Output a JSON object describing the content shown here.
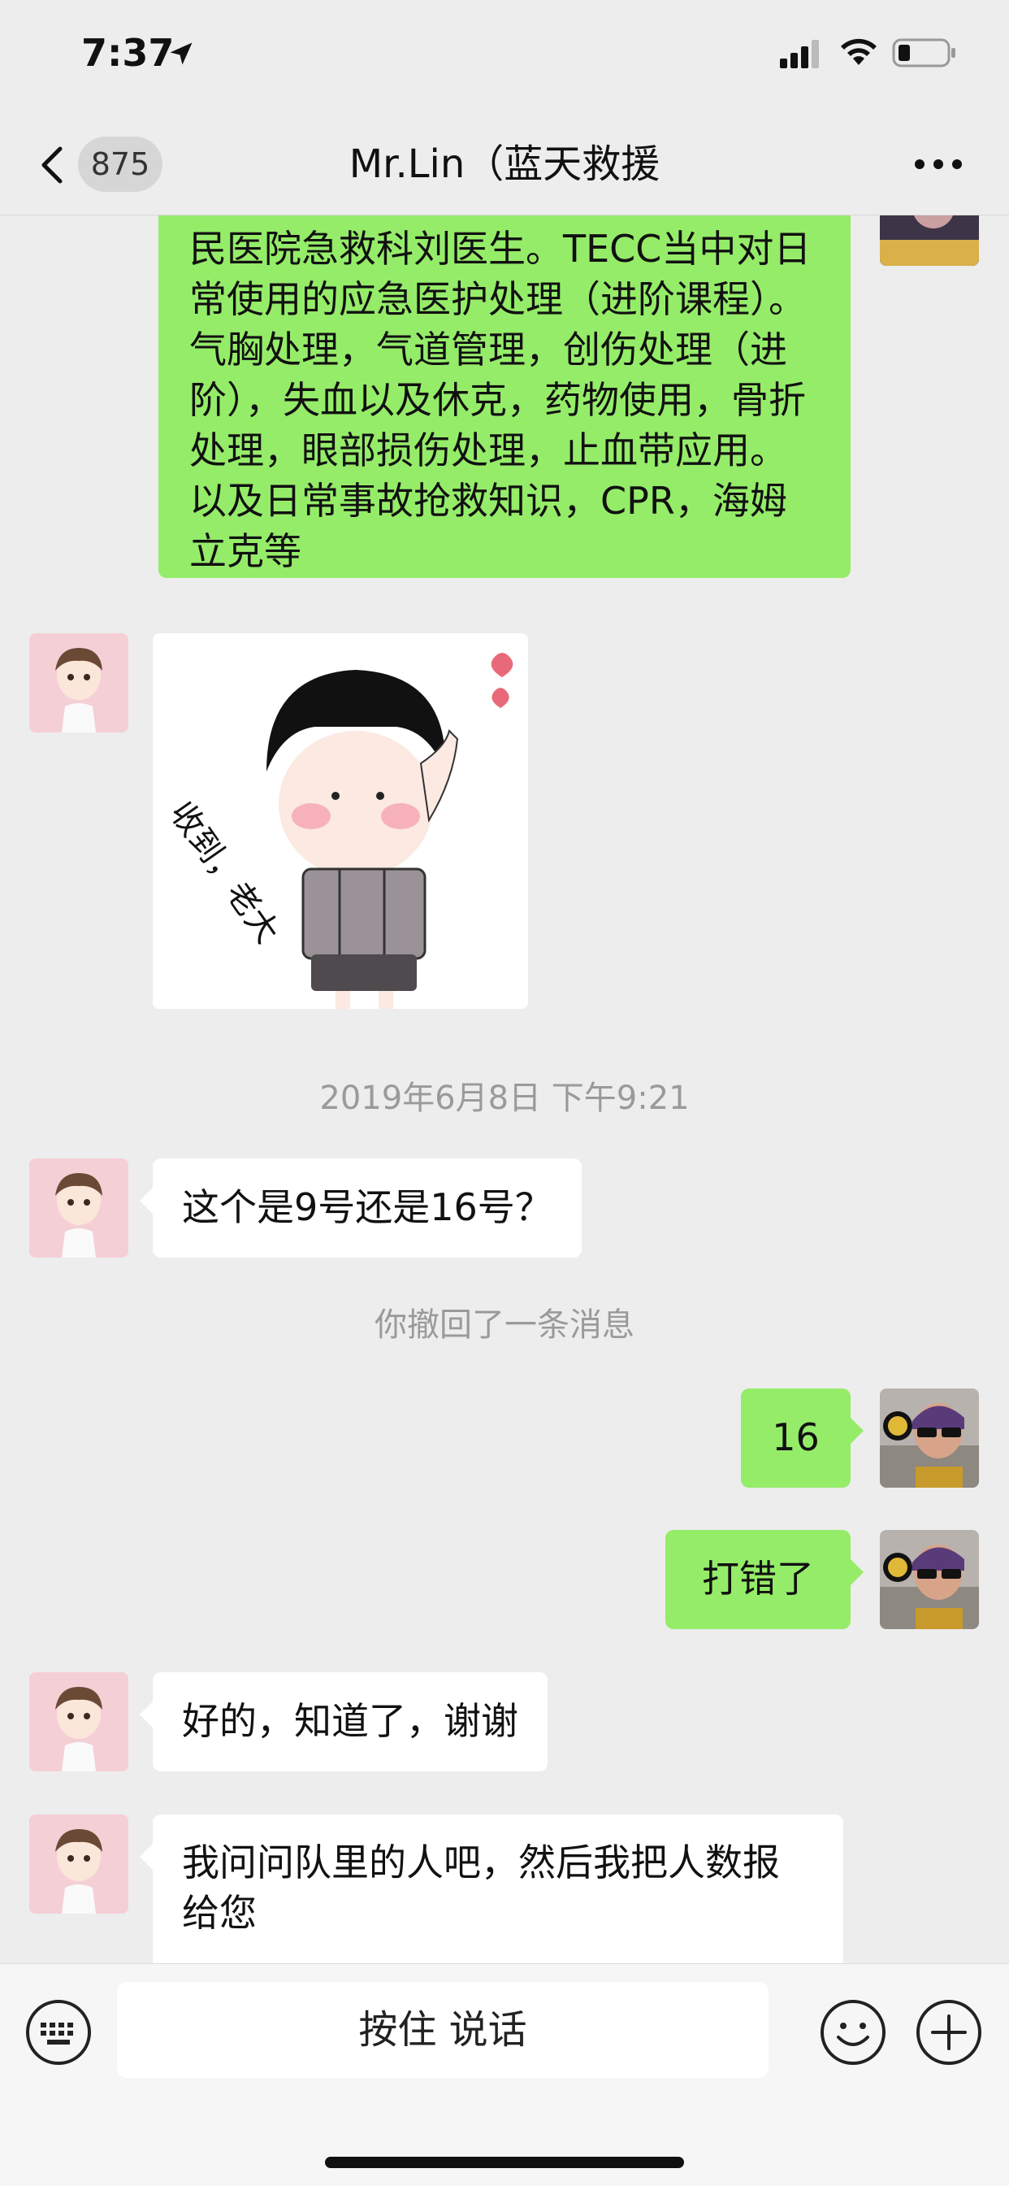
{
  "status_bar": {
    "time": "7:37"
  },
  "nav": {
    "back_badge": "875",
    "title": "Mr.Lin（蓝天救援"
  },
  "messages": {
    "m1": "民医院急救科刘医生。TECC当中对日常使用的应急医护处理（进阶课程）。气胸处理，气道管理，创伤处理（进阶），失血以及休克，药物使用，骨折处理，眼部损伤处理，止血带应用。以及日常事故抢救知识，CPR，海姆立克等",
    "sticker_text": "收到，老大",
    "timestamp": "2019年6月8日 下午9:21",
    "m3": "这个是9号还是16号？",
    "recall_notice": "你撤回了一条消息",
    "m4": "16",
    "m5": "打错了",
    "m6": "好的，知道了，谢谢",
    "m7": "我问问队里的人吧，然后我把人数报给您"
  },
  "input_bar": {
    "voice_label": "按住 说话"
  },
  "colors": {
    "my_bubble": "#95ec69",
    "their_bubble": "#ffffff",
    "background": "#ededed"
  }
}
